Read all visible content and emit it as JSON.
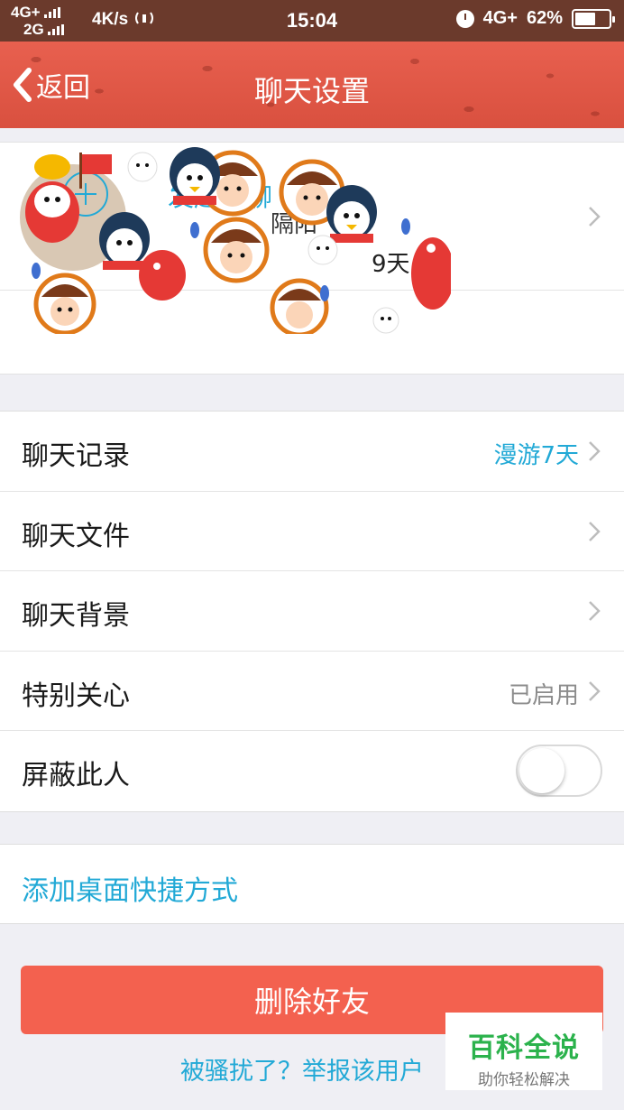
{
  "status_bar": {
    "network_line1": "4G+",
    "network_line2": "2G",
    "speed": "4K/s",
    "time": "15:04",
    "network_right": "4G+",
    "battery": "62%",
    "battery_level": 0.62
  },
  "nav": {
    "back_label": "返回",
    "title": "聊天设置"
  },
  "friend": {
    "name_partial": "隔阳",
    "days_partial": "9天"
  },
  "group": {
    "label": "发起群聊"
  },
  "settings": {
    "rows": [
      {
        "label": "聊天记录",
        "value": "漫游7天"
      },
      {
        "label": "聊天文件",
        "value": ""
      },
      {
        "label": "聊天背景",
        "value": ""
      },
      {
        "label": "特别关心",
        "value": "已启用"
      },
      {
        "label": "屏蔽此人",
        "toggle_on": false
      }
    ]
  },
  "shortcut": {
    "label": "添加桌面快捷方式"
  },
  "actions": {
    "delete_label": "删除好友",
    "report_label": "被骚扰了？举报该用户"
  },
  "watermark": {
    "title": "百科全说",
    "subtitle": "助你轻松解决"
  },
  "colors": {
    "nav_bg": "#e35c4d",
    "status_bg": "#6b3a2c",
    "accent_blue": "#22a9d6",
    "delete_red": "#f3614f",
    "watermark_green": "#2bb24c"
  }
}
